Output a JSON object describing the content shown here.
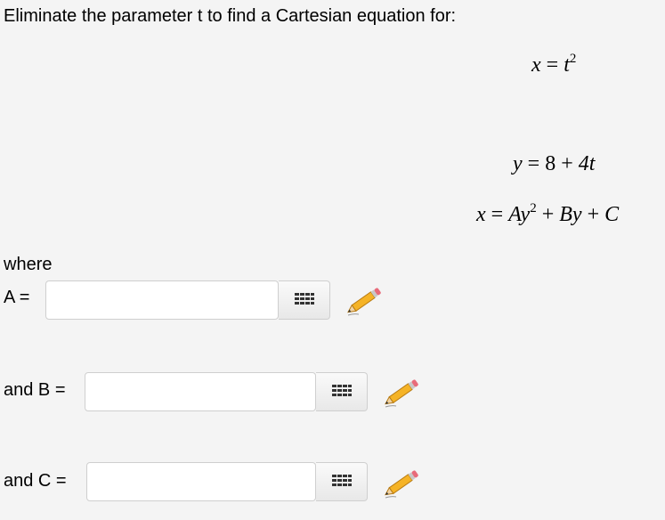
{
  "prompt": "Eliminate the parameter t to find a Cartesian equation for:",
  "equations": {
    "eq1_lhs": "x",
    "eq1_rhs_base": "t",
    "eq1_rhs_exp": "2",
    "eq2_lhs": "y",
    "eq2_rhs_const": "8",
    "eq2_rhs_term": "4t",
    "eq3_lhs": "x",
    "eq3_A": "Ay",
    "eq3_A_exp": "2",
    "eq3_B": "By",
    "eq3_C": "C"
  },
  "where_label": "where",
  "fields": {
    "a_label": "A =",
    "a_value": "",
    "b_label": "and B =",
    "b_value": "",
    "c_label": "and C =",
    "c_value": ""
  },
  "icons": {
    "keyboard": "keypad-icon",
    "edit": "pencil-icon"
  }
}
